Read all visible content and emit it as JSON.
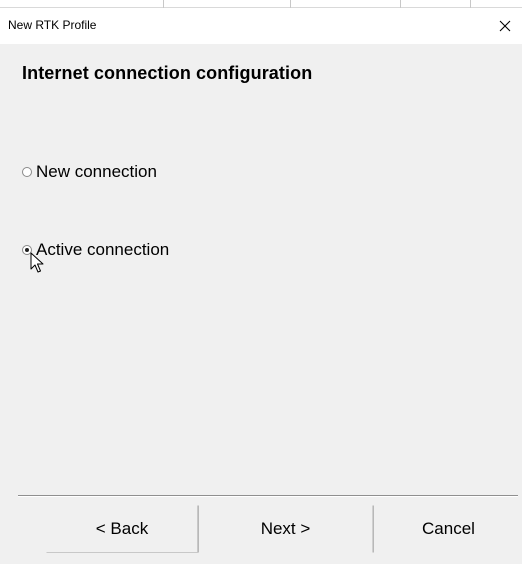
{
  "window": {
    "title": "New RTK Profile",
    "close_icon": "close-icon"
  },
  "page": {
    "heading": "Internet connection configuration"
  },
  "options": [
    {
      "label": "New connection",
      "checked": false
    },
    {
      "label": "Active connection",
      "checked": true
    }
  ],
  "buttons": {
    "back": "< Back",
    "next": "Next >",
    "cancel": "Cancel"
  },
  "icons": {
    "cursor": "mouse-pointer-icon"
  }
}
